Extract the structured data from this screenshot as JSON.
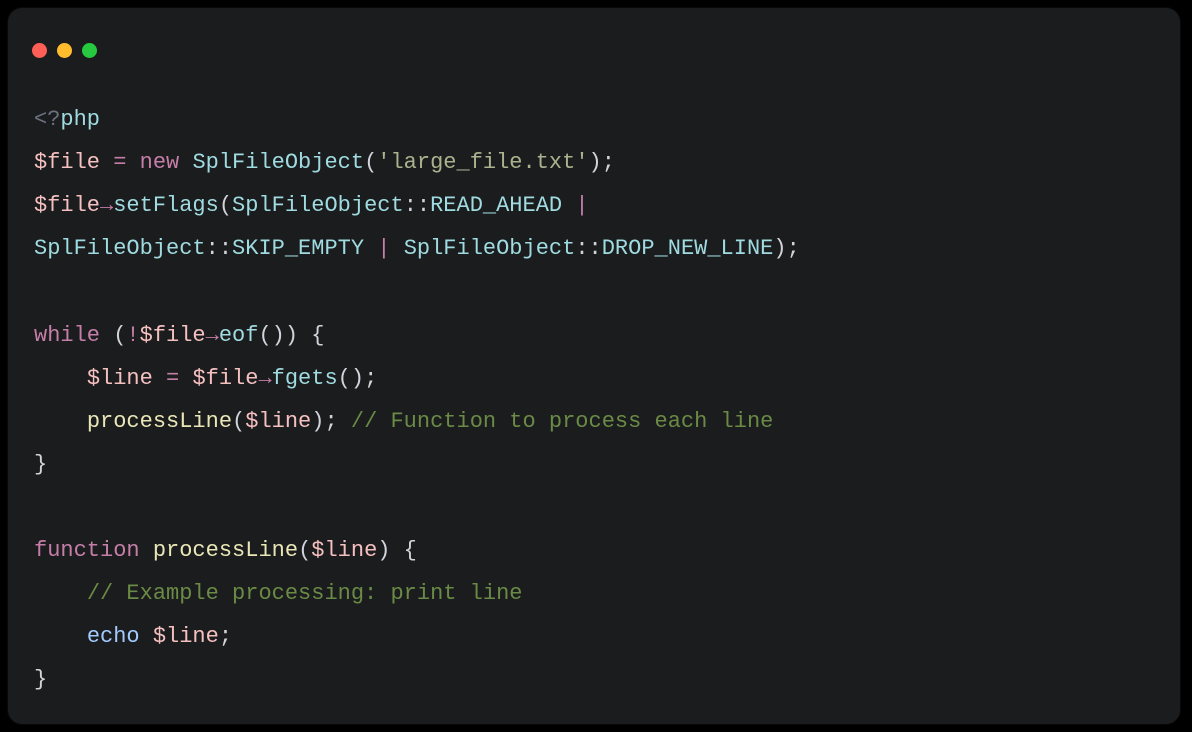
{
  "code": {
    "lines": [
      {
        "n": 0,
        "tokens": [
          {
            "c": "tag",
            "t": "<?"
          },
          {
            "c": "ident",
            "t": "php"
          }
        ]
      },
      {
        "n": 1,
        "tokens": [
          {
            "c": "var",
            "t": "$file"
          },
          {
            "c": "op",
            "t": " "
          },
          {
            "c": "kw",
            "t": "="
          },
          {
            "c": "op",
            "t": " "
          },
          {
            "c": "kw",
            "t": "new"
          },
          {
            "c": "op",
            "t": " "
          },
          {
            "c": "ident",
            "t": "SplFileObject"
          },
          {
            "c": "op",
            "t": "("
          },
          {
            "c": "str",
            "t": "'large_file.txt'"
          },
          {
            "c": "op",
            "t": ");"
          }
        ]
      },
      {
        "n": 2,
        "tokens": [
          {
            "c": "var",
            "t": "$file"
          },
          {
            "c": "kw arrow",
            "t": "→"
          },
          {
            "c": "ident",
            "t": "setFlags"
          },
          {
            "c": "op",
            "t": "("
          },
          {
            "c": "ident",
            "t": "SplFileObject"
          },
          {
            "c": "op",
            "t": "::"
          },
          {
            "c": "ident",
            "t": "READ_AHEAD"
          },
          {
            "c": "op",
            "t": " "
          },
          {
            "c": "kw",
            "t": "|"
          },
          {
            "c": "op",
            "t": " "
          }
        ]
      },
      {
        "n": 3,
        "tokens": [
          {
            "c": "ident",
            "t": "SplFileObject"
          },
          {
            "c": "op",
            "t": "::"
          },
          {
            "c": "ident",
            "t": "SKIP_EMPTY"
          },
          {
            "c": "op",
            "t": " "
          },
          {
            "c": "kw",
            "t": "|"
          },
          {
            "c": "op",
            "t": " "
          },
          {
            "c": "ident",
            "t": "SplFileObject"
          },
          {
            "c": "op",
            "t": "::"
          },
          {
            "c": "ident",
            "t": "DROP_NEW_LINE"
          },
          {
            "c": "op",
            "t": ");"
          }
        ]
      },
      {
        "n": 4,
        "tokens": [
          {
            "c": "op",
            "t": " "
          }
        ]
      },
      {
        "n": 5,
        "tokens": [
          {
            "c": "kw",
            "t": "while"
          },
          {
            "c": "op",
            "t": " ("
          },
          {
            "c": "kw",
            "t": "!"
          },
          {
            "c": "var",
            "t": "$file"
          },
          {
            "c": "kw arrow",
            "t": "→"
          },
          {
            "c": "ident",
            "t": "eof"
          },
          {
            "c": "op",
            "t": "()) {"
          }
        ]
      },
      {
        "n": 6,
        "tokens": [
          {
            "c": "op",
            "t": "    "
          },
          {
            "c": "var",
            "t": "$line"
          },
          {
            "c": "op",
            "t": " "
          },
          {
            "c": "kw",
            "t": "="
          },
          {
            "c": "op",
            "t": " "
          },
          {
            "c": "var",
            "t": "$file"
          },
          {
            "c": "kw arrow",
            "t": "→"
          },
          {
            "c": "ident",
            "t": "fgets"
          },
          {
            "c": "op",
            "t": "();"
          }
        ]
      },
      {
        "n": 7,
        "tokens": [
          {
            "c": "op",
            "t": "    "
          },
          {
            "c": "fn",
            "t": "processLine"
          },
          {
            "c": "op",
            "t": "("
          },
          {
            "c": "var",
            "t": "$line"
          },
          {
            "c": "op",
            "t": "); "
          },
          {
            "c": "cmt",
            "t": "// Function to process each line"
          }
        ]
      },
      {
        "n": 8,
        "tokens": [
          {
            "c": "op",
            "t": "}"
          }
        ]
      },
      {
        "n": 9,
        "tokens": [
          {
            "c": "op",
            "t": " "
          }
        ]
      },
      {
        "n": 10,
        "tokens": [
          {
            "c": "kw",
            "t": "function"
          },
          {
            "c": "op",
            "t": " "
          },
          {
            "c": "fn",
            "t": "processLine"
          },
          {
            "c": "op",
            "t": "("
          },
          {
            "c": "var",
            "t": "$line"
          },
          {
            "c": "op",
            "t": ") {"
          }
        ]
      },
      {
        "n": 11,
        "tokens": [
          {
            "c": "op",
            "t": "    "
          },
          {
            "c": "cmt",
            "t": "// Example processing: print line"
          }
        ]
      },
      {
        "n": 12,
        "tokens": [
          {
            "c": "op",
            "t": "    "
          },
          {
            "c": "echo",
            "t": "echo"
          },
          {
            "c": "op",
            "t": " "
          },
          {
            "c": "var",
            "t": "$line"
          },
          {
            "c": "op",
            "t": ";"
          }
        ]
      },
      {
        "n": 13,
        "tokens": [
          {
            "c": "op",
            "t": "}"
          }
        ]
      }
    ]
  },
  "window_controls": {
    "close": "close",
    "minimize": "minimize",
    "zoom": "zoom"
  }
}
